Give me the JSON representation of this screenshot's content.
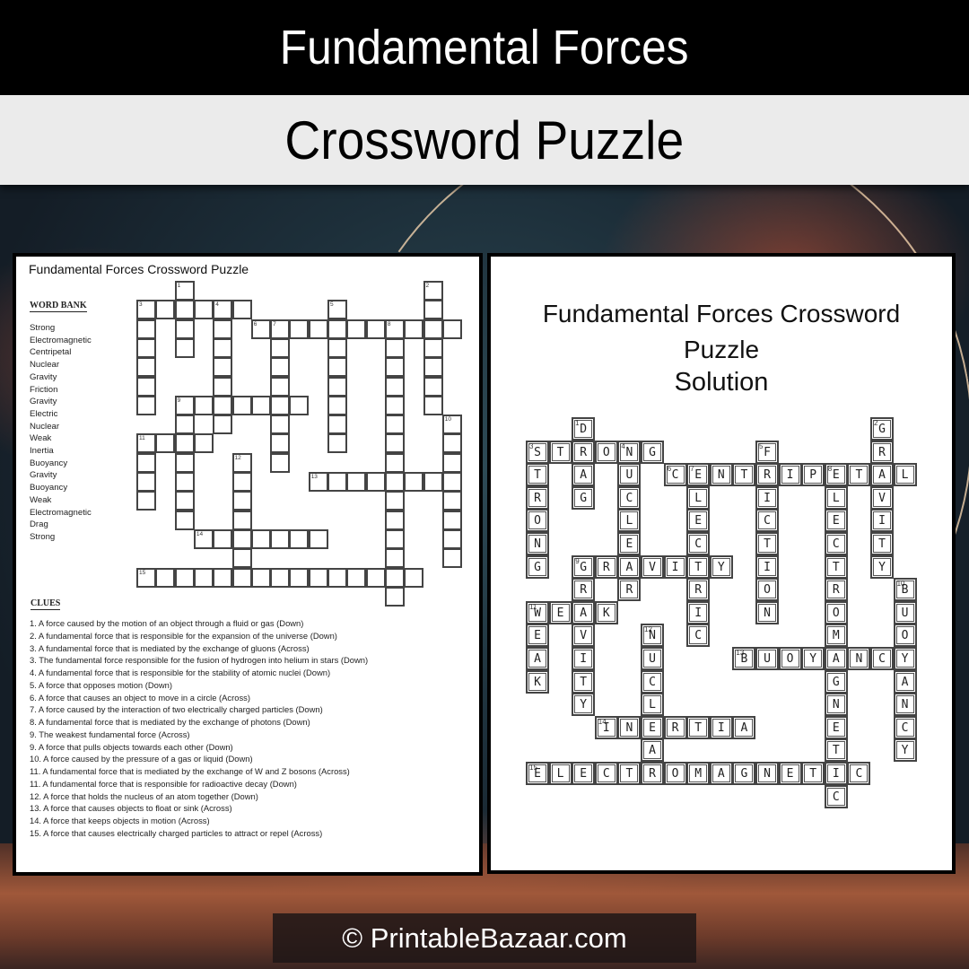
{
  "header": {
    "title": "Fundamental Forces",
    "subtitle": "Crossword Puzzle"
  },
  "worksheet": {
    "title": "Fundamental Forces Crossword Puzzle",
    "word_bank_title": "WORD BANK",
    "word_bank": [
      "Strong",
      "Electromagnetic",
      "Centripetal",
      "Nuclear",
      "Gravity",
      "Friction",
      "Gravity",
      "Electric",
      "Nuclear",
      "Weak",
      "Inertia",
      "Buoyancy",
      "Gravity",
      "Buoyancy",
      "Weak",
      "Electromagnetic",
      "Drag",
      "Strong"
    ],
    "clues_title": "CLUES",
    "clues": [
      "1. A force caused by the motion of an object through a fluid or gas (Down)",
      "2. A fundamental force that is responsible for the expansion of the universe (Down)",
      "3. A fundamental force that is mediated by the exchange of gluons (Across)",
      "3. The fundamental force responsible for the fusion of hydrogen into helium in stars (Down)",
      "4. A fundamental force that is responsible for the stability of atomic nuclei (Down)",
      "5. A force that opposes motion  (Down)",
      "6. A force that causes an object to move in a circle (Across)",
      "7. A force caused by the interaction of two electrically charged particles (Down)",
      "8. A fundamental force that is mediated by the exchange of photons (Down)",
      "9. The weakest fundamental force (Across)",
      "9. A force that pulls objects towards each other  (Down)",
      "10. A force caused by the pressure of a gas or liquid (Down)",
      "11. A fundamental force that is mediated by the exchange of W and Z bosons (Across)",
      "11. A fundamental force that is responsible for radioactive decay (Down)",
      "12. A force that holds the nucleus of an atom together (Down)",
      "13. A force that causes objects to float or sink (Across)",
      "14. A force that keeps objects in motion (Across)",
      "15. A force that causes electrically charged particles to attract or repel (Across)"
    ]
  },
  "solution": {
    "title": "Fundamental Forces Crossword Puzzle",
    "subtitle": "Solution"
  },
  "crossword": {
    "columns": 17,
    "rows": 17,
    "entries": [
      {
        "number": 1,
        "direction": "down",
        "row": 0,
        "col": 2,
        "answer": "DRAG"
      },
      {
        "number": 2,
        "direction": "down",
        "row": 0,
        "col": 15,
        "answer": "GRAVITY"
      },
      {
        "number": 3,
        "direction": "across",
        "row": 1,
        "col": 0,
        "answer": "STRONG"
      },
      {
        "number": 3,
        "direction": "down",
        "row": 1,
        "col": 0,
        "answer": "STRONG"
      },
      {
        "number": 4,
        "direction": "down",
        "row": 1,
        "col": 4,
        "answer": "NUCLEAR"
      },
      {
        "number": 5,
        "direction": "down",
        "row": 1,
        "col": 10,
        "answer": "FRICTION"
      },
      {
        "number": 6,
        "direction": "across",
        "row": 2,
        "col": 6,
        "answer": "CENTRIPETAL"
      },
      {
        "number": 7,
        "direction": "down",
        "row": 2,
        "col": 7,
        "answer": "ELECTRIC"
      },
      {
        "number": 8,
        "direction": "down",
        "row": 2,
        "col": 13,
        "answer": "ELECTROMAGNETIC"
      },
      {
        "number": 9,
        "direction": "across",
        "row": 6,
        "col": 2,
        "answer": "GRAVITY"
      },
      {
        "number": 9,
        "direction": "down",
        "row": 6,
        "col": 2,
        "answer": "GRAVITY"
      },
      {
        "number": 10,
        "direction": "down",
        "row": 7,
        "col": 16,
        "answer": "BUOYANCY"
      },
      {
        "number": 11,
        "direction": "across",
        "row": 8,
        "col": 0,
        "answer": "WEAK"
      },
      {
        "number": 11,
        "direction": "down",
        "row": 8,
        "col": 0,
        "answer": "WEAK"
      },
      {
        "number": 12,
        "direction": "down",
        "row": 9,
        "col": 5,
        "answer": "NUCLEAR"
      },
      {
        "number": 13,
        "direction": "across",
        "row": 10,
        "col": 9,
        "answer": "BUOYANCY"
      },
      {
        "number": 14,
        "direction": "across",
        "row": 13,
        "col": 3,
        "answer": "INERTIA"
      },
      {
        "number": 15,
        "direction": "across",
        "row": 15,
        "col": 0,
        "answer": "ELECTROMAGNETIC"
      }
    ]
  },
  "footer": {
    "copyright": "© PrintableBazaar.com"
  }
}
